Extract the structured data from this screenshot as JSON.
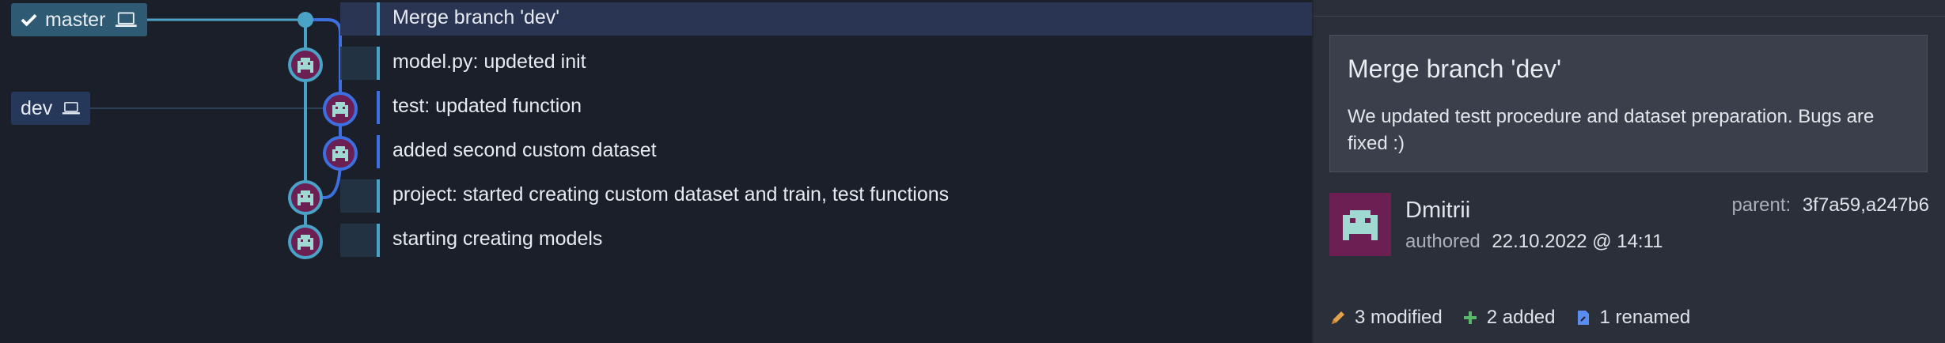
{
  "branches": {
    "master": {
      "label": "master",
      "color": "#2e5a74"
    },
    "dev": {
      "label": "dev",
      "color": "#25385a"
    }
  },
  "commits": [
    {
      "message": "Merge branch 'dev'",
      "selected": true,
      "lane": "master"
    },
    {
      "message": "model.py: updeted init",
      "lane": "master"
    },
    {
      "message": "test: updated function",
      "lane": "dev"
    },
    {
      "message": "added second custom dataset",
      "lane": "dev"
    },
    {
      "message": "project: started creating custom dataset and train, test functions",
      "lane": "master"
    },
    {
      "message": "starting creating models",
      "lane": "master"
    }
  ],
  "details": {
    "title": "Merge branch 'dev'",
    "body": "We updated testt procedure and dataset preparation. Bugs are fixed :)",
    "author": "Dmitrii",
    "authored_label": "authored",
    "date": "22.10.2022 @ 14:11",
    "parent_label": "parent:",
    "parents": "3f7a59,a247b6",
    "stats": {
      "modified": "3 modified",
      "added": "2 added",
      "renamed": "1 renamed"
    }
  },
  "colors": {
    "master_lane": "#4aa3c7",
    "dev_lane": "#3e6fe0",
    "avatar_bg": "#6b1f52",
    "avatar_fg": "#9fd9d2",
    "modified_icon": "#e5a14a",
    "added_icon": "#59b86a",
    "renamed_icon": "#5a8df0"
  }
}
